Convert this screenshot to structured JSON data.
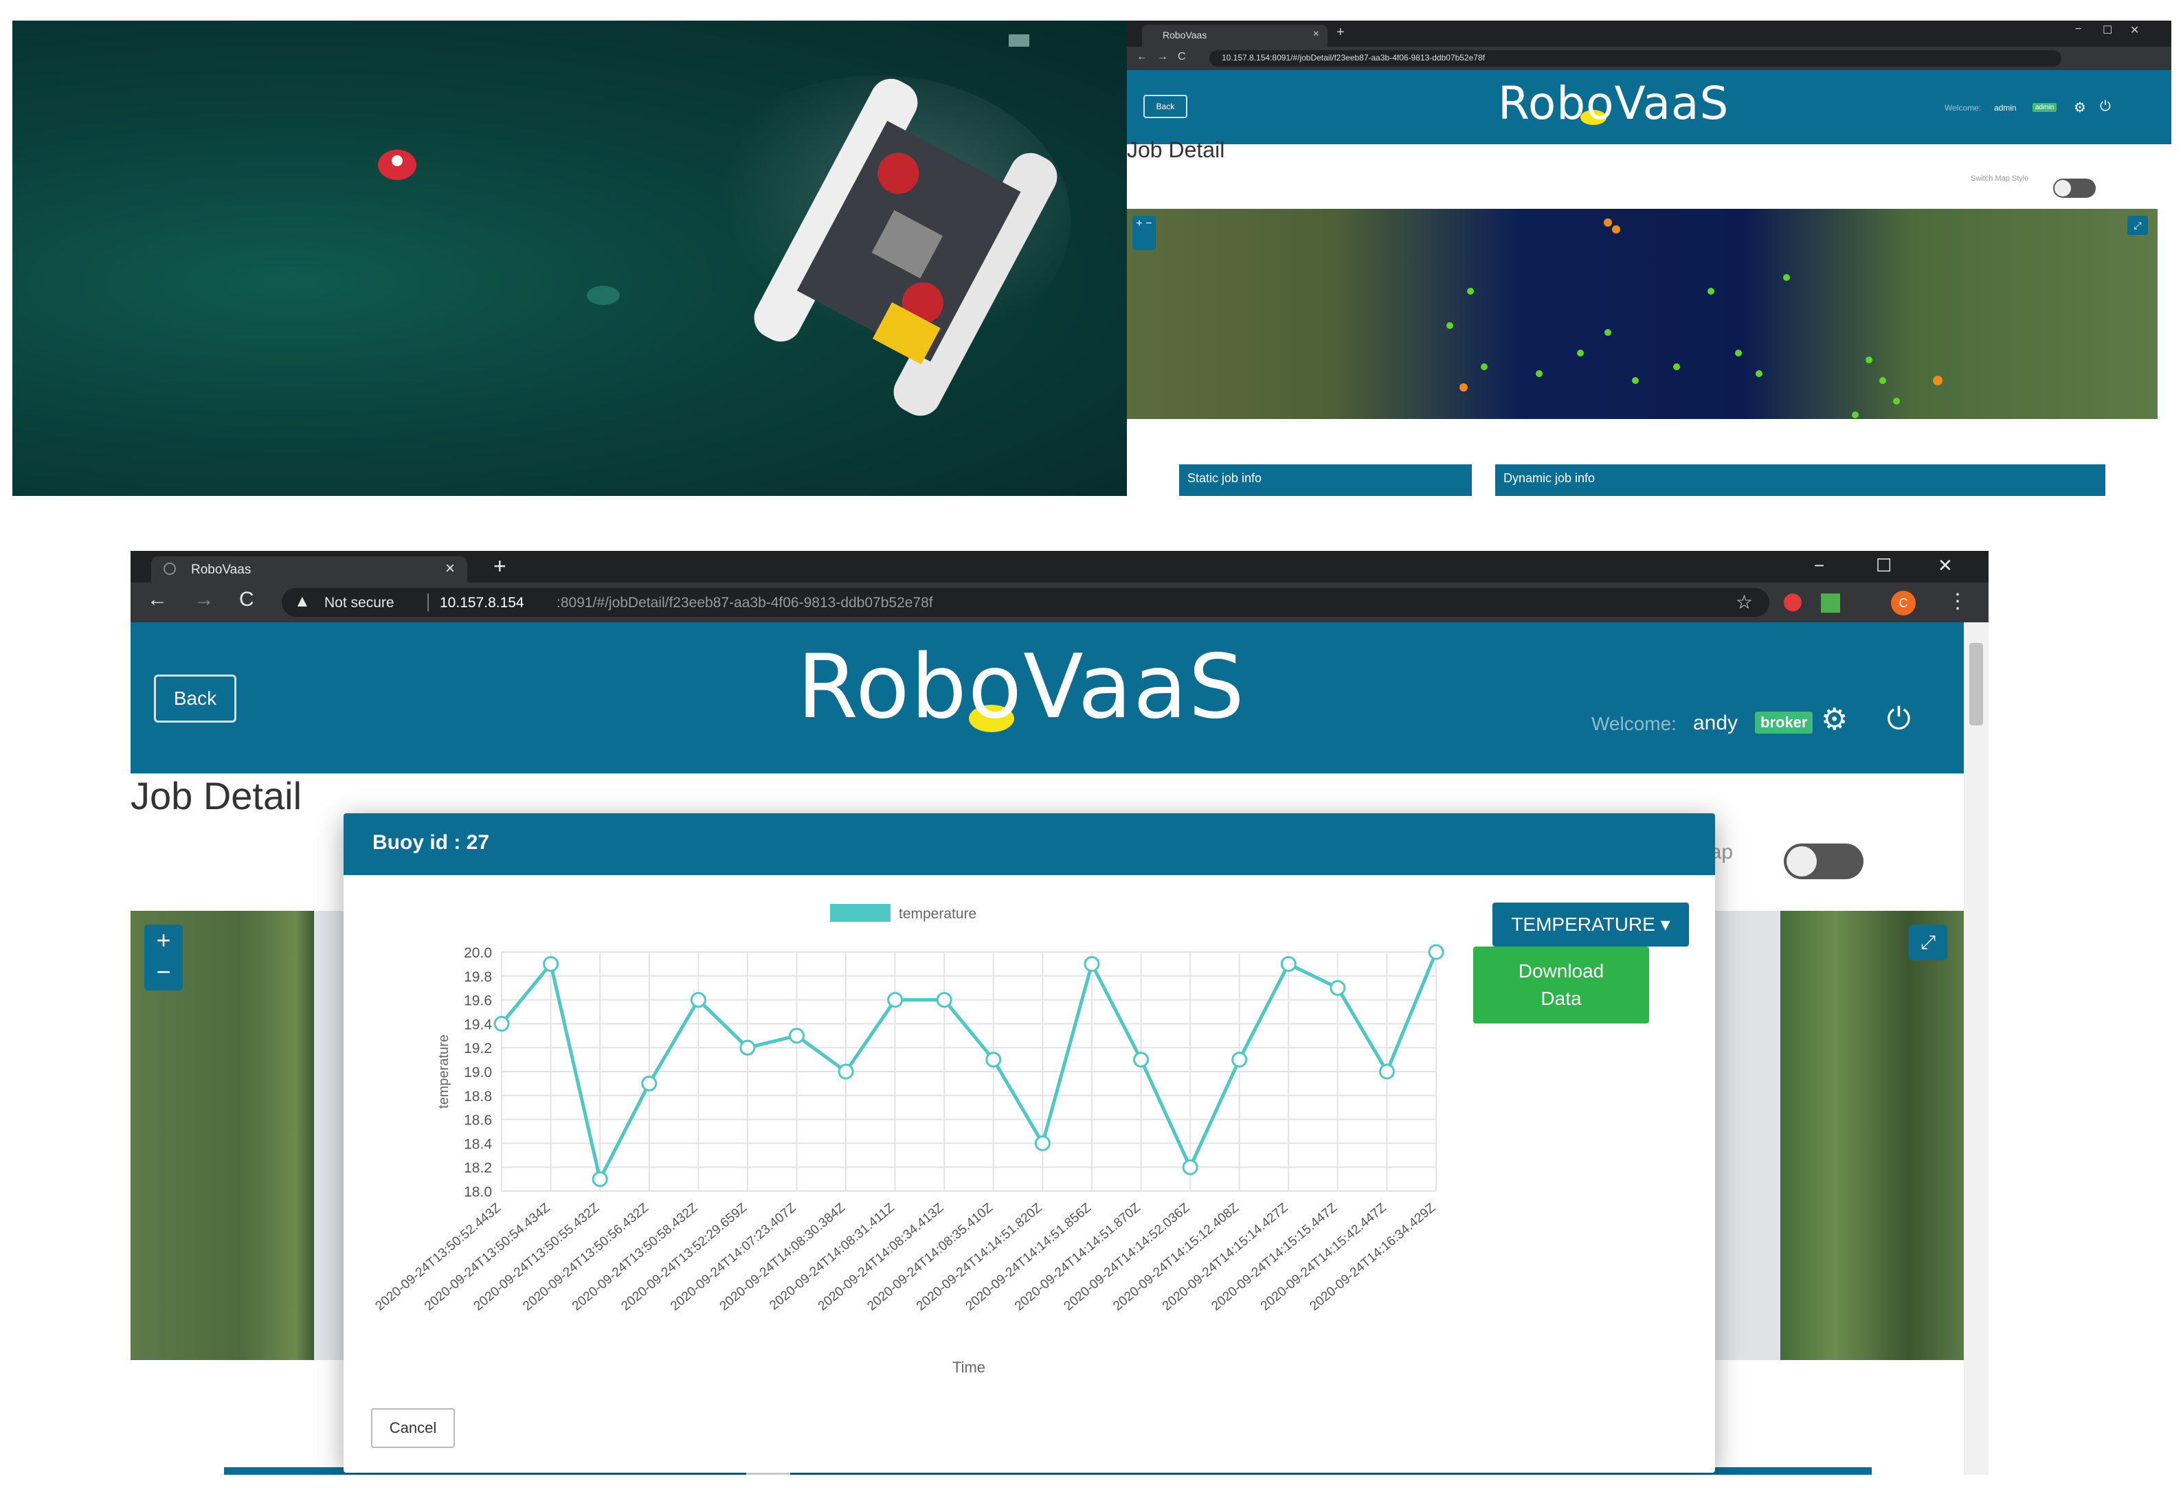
{
  "top_right_window": {
    "tab_title": "RoboVaas",
    "address": "10.157.8.154:8091/#/jobDetail/f23eeb87-aa3b-4f06-9813-ddb07b52e78f",
    "back_label": "Back",
    "logo": "RoboVaaS",
    "welcome_label": "Welcome:",
    "user": "admin",
    "role": "admin",
    "page_title": "Job Detail",
    "switch_label": "Switch Map Style",
    "zoom_label": "+ −",
    "cards": [
      "Static job info",
      "Dynamic job info"
    ]
  },
  "browser": {
    "tab_title": "RoboVaas",
    "tab_close": "×",
    "new_tab": "+",
    "window_controls": [
      "−",
      "☐",
      "✕"
    ],
    "nav": {
      "back": "←",
      "forward": "→",
      "reload": "C"
    },
    "security_warning": "Not secure",
    "url_host": "10.157.8.154",
    "url_path": ":8091/#/jobDetail/f23eeb87-aa3b-4f06-9813-ddb07b52e78f",
    "avatar_letter": "C"
  },
  "header": {
    "back_label": "Back",
    "logo": "RoboVaaS",
    "welcome_label": "Welcome:",
    "user": "andy",
    "role": "broker"
  },
  "page": {
    "title": "Job Detail",
    "map_label": "lap",
    "zoom_in": "+",
    "zoom_out": "−"
  },
  "modal": {
    "title": "Buoy id : 27",
    "dropdown_label": "TEMPERATURE",
    "download_label_line1": "Download",
    "download_label_line2": "Data",
    "cancel_label": "Cancel"
  },
  "colors": {
    "brand_blue": "#0b6d91",
    "line": "#4fc7c4",
    "download_green": "#2db34a",
    "role_badge": "#3dbb7a"
  },
  "chart_data": {
    "type": "line",
    "title": "",
    "xlabel": "Time",
    "ylabel": "temperature",
    "legend": [
      "temperature"
    ],
    "legend_position": "top",
    "ylim": [
      18.0,
      20.0
    ],
    "yticks": [
      "18.0",
      "18.2",
      "18.4",
      "18.6",
      "18.8",
      "19.0",
      "19.2",
      "19.4",
      "19.6",
      "19.8",
      "20.0"
    ],
    "grid": true,
    "categories": [
      "2020-09-24T13:50:52.443Z",
      "2020-09-24T13:50:54.434Z",
      "2020-09-24T13:50:55.432Z",
      "2020-09-24T13:50:56.432Z",
      "2020-09-24T13:50:58.432Z",
      "2020-09-24T13:52:29.659Z",
      "2020-09-24T14:07:23.407Z",
      "2020-09-24T14:08:30.384Z",
      "2020-09-24T14:08:31.411Z",
      "2020-09-24T14:08:34.413Z",
      "2020-09-24T14:08:35.410Z",
      "2020-09-24T14:14:51.820Z",
      "2020-09-24T14:14:51.856Z",
      "2020-09-24T14:14:51.870Z",
      "2020-09-24T14:14:52.036Z",
      "2020-09-24T14:15:12.408Z",
      "2020-09-24T14:15:14.427Z",
      "2020-09-24T14:15:15.447Z",
      "2020-09-24T14:15:42.447Z",
      "2020-09-24T14:16:34.429Z"
    ],
    "series": [
      {
        "name": "temperature",
        "values": [
          19.4,
          19.9,
          18.1,
          18.9,
          19.6,
          19.2,
          19.3,
          19.0,
          19.6,
          19.6,
          19.1,
          18.4,
          19.9,
          19.1,
          18.2,
          19.1,
          19.9,
          19.7,
          19.0,
          20.0
        ]
      }
    ]
  }
}
